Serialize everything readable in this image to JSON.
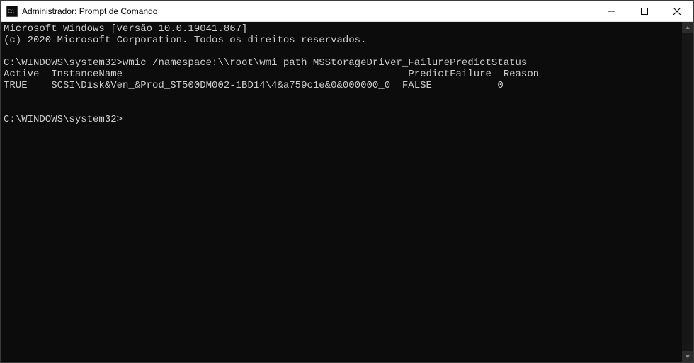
{
  "titlebar": {
    "title": "Administrador: Prompt de Comando"
  },
  "terminal": {
    "line1": "Microsoft Windows [versão 10.0.19041.867]",
    "line2": "(c) 2020 Microsoft Corporation. Todos os direitos reservados.",
    "blank1": "",
    "cmd_prompt1": "C:\\WINDOWS\\system32>",
    "cmd_text1": "wmic /namespace:\\\\root\\wmi path MSStorageDriver_FailurePredictStatus",
    "header_row": "Active  InstanceName                                                PredictFailure  Reason",
    "data_row": "TRUE    SCSI\\Disk&Ven_&Prod_ST500DM002-1BD14\\4&a759c1e&0&000000_0  FALSE           0",
    "blank2": "",
    "blank3": "",
    "cmd_prompt2": "C:\\WINDOWS\\system32>"
  }
}
